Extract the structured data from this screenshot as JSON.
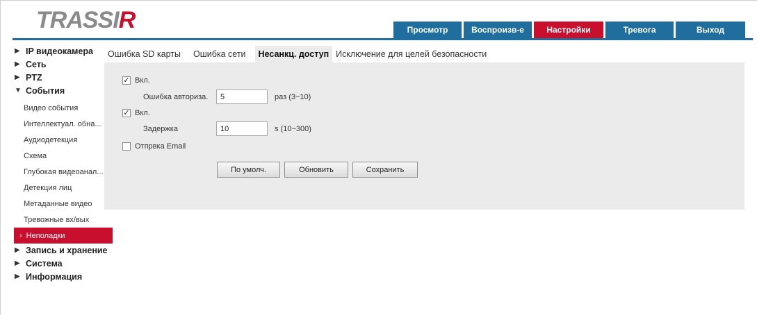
{
  "header": {
    "logo_text": "TRASSIR",
    "nav": [
      {
        "label": "Просмотр",
        "active": false
      },
      {
        "label": "Воспроизв-е",
        "active": false
      },
      {
        "label": "Настройки",
        "active": true
      },
      {
        "label": "Тревога",
        "active": false
      },
      {
        "label": "Выход",
        "active": false
      }
    ]
  },
  "sidebar": {
    "top": [
      {
        "label": "IP видеокамера"
      },
      {
        "label": "Сеть"
      },
      {
        "label": "PTZ"
      }
    ],
    "events": {
      "label": "События",
      "items": [
        {
          "label": "Видео события"
        },
        {
          "label": "Интеллектуал. обна..."
        },
        {
          "label": "Аудиодетекция"
        },
        {
          "label": "Схема"
        },
        {
          "label": "Глубокая видеоанал..."
        },
        {
          "label": "Детекция лиц"
        },
        {
          "label": "Метаданные видео"
        },
        {
          "label": "Тревожные вх/вых"
        },
        {
          "label": "Неполадки",
          "active": true
        }
      ]
    },
    "bottom": [
      {
        "label": "Запись и хранение"
      },
      {
        "label": "Система"
      },
      {
        "label": "Информация"
      }
    ]
  },
  "tabs": [
    {
      "label": "Ошибка SD карты",
      "active": false
    },
    {
      "label": "Ошибка сети",
      "active": false
    },
    {
      "label": "Несанкц. доступ",
      "active": true
    },
    {
      "label": "Исключение для целей безопасности",
      "active": false
    }
  ],
  "form": {
    "enable1": {
      "label": "Вкл.",
      "checked": true
    },
    "auth_error": {
      "label": "Ошибка авториза.",
      "value": "5",
      "hint": "раз (3~10)"
    },
    "enable2": {
      "label": "Вкл.",
      "checked": true
    },
    "delay": {
      "label": "Задержка",
      "value": "10",
      "hint": "s (10~300)"
    },
    "send_email": {
      "label": "Отпрвка Email",
      "checked": false
    }
  },
  "buttons": {
    "default": "По умолч.",
    "refresh": "Обновить",
    "save": "Сохранить"
  },
  "colors": {
    "brand_blue": "#1f6e9e",
    "accent_red": "#c8102e",
    "panel_gray": "#ebebeb"
  }
}
